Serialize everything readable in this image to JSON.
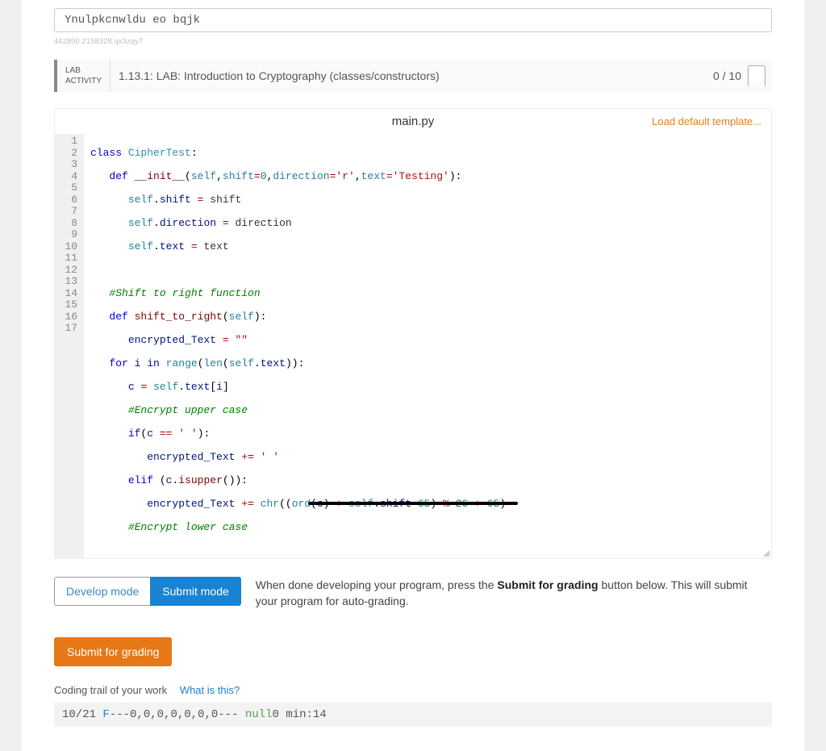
{
  "search": {
    "value": "Ynulpkcnwldu eo bqjk"
  },
  "tiny_meta": "442800.2158328.qx3zqy7",
  "lab": {
    "tag_line1": "LAB",
    "tag_line2": "ACTIVITY",
    "title": "1.13.1: LAB: Introduction to Cryptography (classes/constructors)",
    "score": "0 / 10"
  },
  "editor": {
    "filename": "main.py",
    "load_template": "Load default template...",
    "lines": 17
  },
  "modes": {
    "develop": "Develop mode",
    "submit": "Submit mode",
    "help_pre": "When done developing your program, press the ",
    "help_bold": "Submit for grading",
    "help_post": " button below. This will submit your program for auto-grading."
  },
  "submit_grading": "Submit for grading",
  "trail": {
    "label": "Coding trail of your work",
    "what": "What is this?",
    "date": "10/21",
    "day": "F",
    "scores": "---0,0,0,0,0,0,0---",
    "null": "null",
    "time": "0 min:14"
  }
}
